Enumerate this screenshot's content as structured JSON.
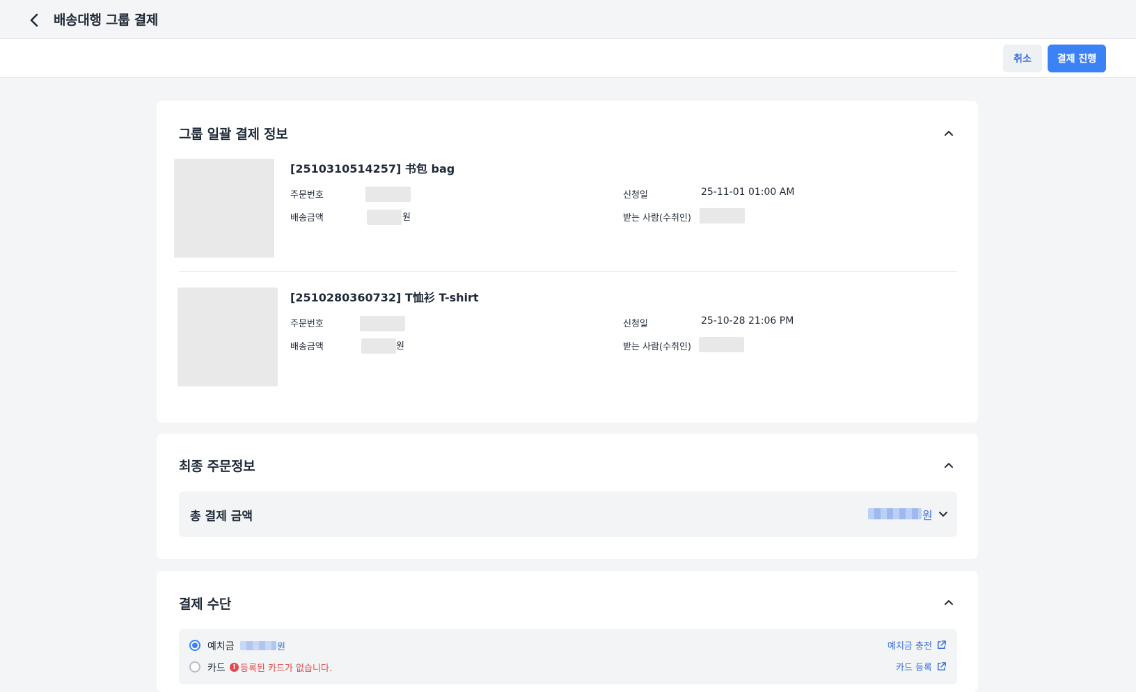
{
  "header": {
    "back_icon": "chevron-left-icon",
    "title": "배송대행 그룹 결제"
  },
  "toolbar": {
    "cancel_label": "취소",
    "pay_label": "결제 진행",
    "accent": "#3b82f6"
  },
  "group_payment": {
    "title": "그룹 일괄 결제 정보",
    "items": [
      {
        "title": "[2510310514257] 书包 bag",
        "order_no_label": "주문번호",
        "shipping_label": "배송금액",
        "currency_suffix": "원",
        "date_label": "신청일",
        "date_value": "25-11-01 01:00 AM",
        "recipient_label": "받는 사람(수취인)"
      },
      {
        "title": "[2510280360732] T恤衫 T-shirt",
        "order_no_label": "주문번호",
        "shipping_label": "배송금액",
        "currency_suffix": "원",
        "date_label": "신청일",
        "date_value": "25-10-28 21:06 PM",
        "recipient_label": "받는 사람(수취인)"
      }
    ]
  },
  "final_order": {
    "title": "최종 주문정보",
    "total_label": "총 결제 금액",
    "currency_suffix": "원"
  },
  "payment_method": {
    "title": "결제 수단",
    "options": [
      {
        "label": "예치금",
        "currency_suffix": "원",
        "selected": true,
        "link_label": "예치금 충전"
      },
      {
        "label": "카드",
        "selected": false,
        "error_text": "등록된 카드가 없습니다.",
        "link_label": "카드 등록"
      }
    ]
  },
  "colors": {
    "link": "#3a6fd8",
    "error": "#e5484d",
    "background": "#f4f5f6"
  }
}
